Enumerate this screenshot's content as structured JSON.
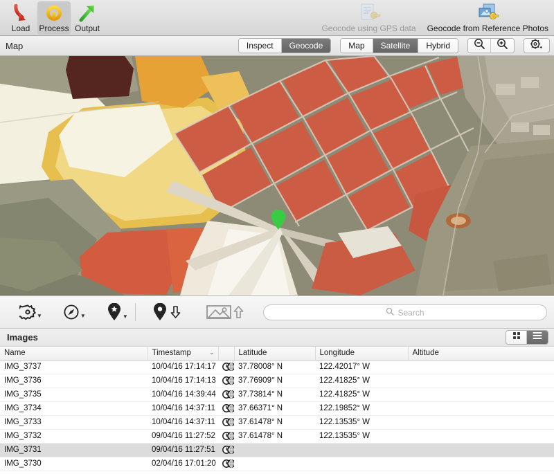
{
  "toolbar": {
    "items": [
      {
        "label": "Load",
        "icon": "load-arrow-icon",
        "selected": false,
        "disabled": false
      },
      {
        "label": "Process",
        "icon": "process-circle-icon",
        "selected": true,
        "disabled": false
      },
      {
        "label": "Output",
        "icon": "output-arrow-icon",
        "selected": false,
        "disabled": false
      }
    ],
    "right_items": [
      {
        "label": "Geocode using GPS data",
        "icon": "gps-document-key-icon",
        "disabled": true
      },
      {
        "label": "Geocode from Reference Photos",
        "icon": "reference-photos-key-icon",
        "disabled": false
      }
    ]
  },
  "map_header": {
    "title": "Map",
    "mode_segments": [
      {
        "label": "Inspect",
        "selected": false
      },
      {
        "label": "Geocode",
        "selected": true
      }
    ],
    "layer_segments": [
      {
        "label": "Map",
        "selected": false
      },
      {
        "label": "Satellite",
        "selected": true
      },
      {
        "label": "Hybrid",
        "selected": false
      }
    ],
    "zoom_out": "zoom-out-icon",
    "zoom_in": "zoom-in-icon",
    "settings": "gear-dropdown-icon"
  },
  "map": {
    "marker": {
      "name": "green-map-pin",
      "color": "#3fcc4d"
    },
    "colors": {
      "land": "#8c8a73",
      "pond_white": "#f7f4e7",
      "pond_yellow": "#e9c24b",
      "pond_orange": "#e09b5a",
      "pond_red": "#cf6149",
      "pond_darkred": "#5c2b26",
      "water": "#9fa08a",
      "urban": "#b9b3a4"
    }
  },
  "map_toolbar": {
    "buttons": [
      {
        "name": "gear-options-button",
        "icon": "gear-icon",
        "caret": true,
        "disabled": false
      },
      {
        "name": "compass-button",
        "icon": "compass-icon",
        "caret": true,
        "disabled": false
      },
      {
        "name": "place-marker-button",
        "icon": "pin-star-icon",
        "caret": true,
        "disabled": false
      },
      {
        "name": "pin-download-button",
        "icon": "pin-down-icon",
        "caret": false,
        "disabled": false
      },
      {
        "name": "photo-upload-button",
        "icon": "image-up-icon",
        "caret": false,
        "disabled": true
      }
    ]
  },
  "search": {
    "placeholder": "Search",
    "value": "",
    "icon": "search-icon"
  },
  "images_panel": {
    "title": "Images",
    "view_modes": [
      {
        "name": "grid-view-button",
        "icon": "grid-icon",
        "selected": false
      },
      {
        "name": "list-view-button",
        "icon": "list-icon",
        "selected": true
      }
    ],
    "columns": [
      {
        "label": "Name",
        "sorted": false
      },
      {
        "label": "Timestamp",
        "sorted": true
      },
      {
        "label": "",
        "sorted": false
      },
      {
        "label": "Latitude",
        "sorted": false
      },
      {
        "label": "Longitude",
        "sorted": false
      },
      {
        "label": "Altitude",
        "sorted": false
      }
    ],
    "rows": [
      {
        "name": "IMG_3737",
        "timestamp": "10/04/16 17:14:17",
        "badge": "clock-globe",
        "latitude": "37.78008° N",
        "longitude": "122.42017° W",
        "altitude": "",
        "selected": false,
        "no_geo": false
      },
      {
        "name": "IMG_3736",
        "timestamp": "10/04/16 17:14:13",
        "badge": "clock-globe",
        "latitude": "37.76909° N",
        "longitude": "122.41825° W",
        "altitude": "",
        "selected": false,
        "no_geo": false
      },
      {
        "name": "IMG_3735",
        "timestamp": "10/04/16 14:39:44",
        "badge": "clock-globe",
        "latitude": "37.73814° N",
        "longitude": "122.41825° W",
        "altitude": "",
        "selected": false,
        "no_geo": false
      },
      {
        "name": "IMG_3734",
        "timestamp": "10/04/16 14:37:11",
        "badge": "clock-globe",
        "latitude": "37.66371° N",
        "longitude": "122.19852° W",
        "altitude": "",
        "selected": false,
        "no_geo": false
      },
      {
        "name": "IMG_3733",
        "timestamp": "10/04/16 14:37:11",
        "badge": "clock-globe",
        "latitude": "37.61478° N",
        "longitude": "122.13535° W",
        "altitude": "",
        "selected": false,
        "no_geo": false
      },
      {
        "name": "IMG_3732",
        "timestamp": "09/04/16 11:27:52",
        "badge": "clock-globe",
        "latitude": "37.61478° N",
        "longitude": "122.13535° W",
        "altitude": "",
        "selected": false,
        "no_geo": false
      },
      {
        "name": "IMG_3731",
        "timestamp": "09/04/16 11:27:51",
        "badge": "clock-globe",
        "latitude": "",
        "longitude": "",
        "altitude": "",
        "selected": true,
        "no_geo": true
      },
      {
        "name": "IMG_3730",
        "timestamp": "02/04/16 17:01:20",
        "badge": "clock-globe",
        "latitude": "",
        "longitude": "",
        "altitude": "",
        "selected": false,
        "no_geo": true
      }
    ]
  }
}
